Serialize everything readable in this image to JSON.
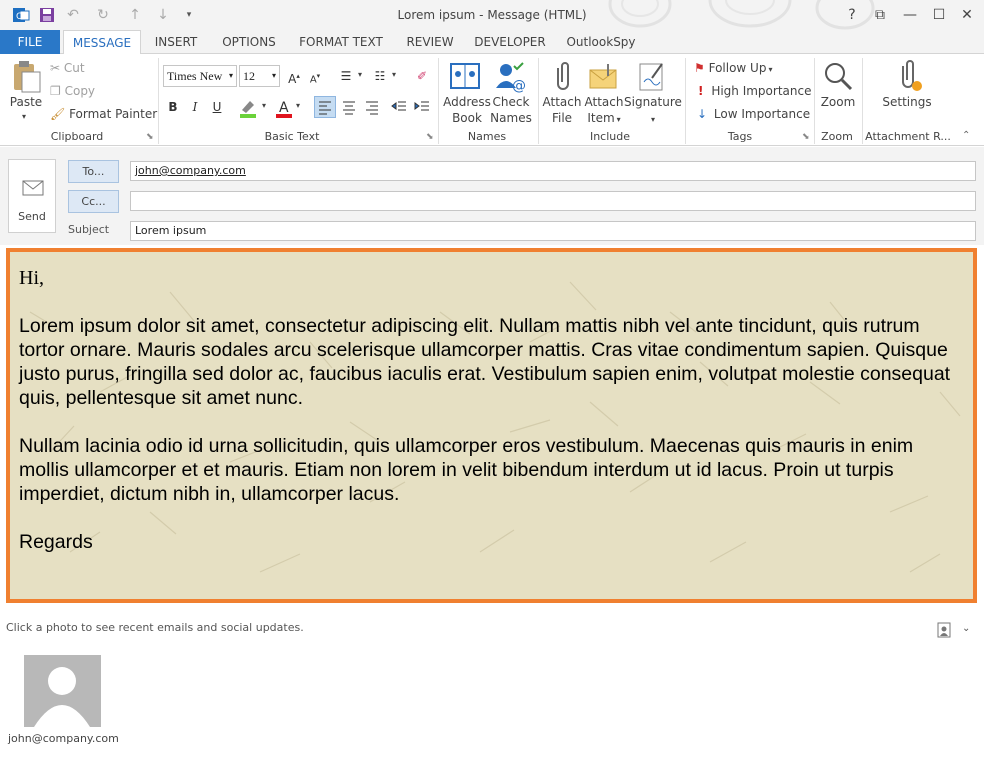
{
  "window": {
    "title": "Lorem ipsum - Message (HTML)",
    "help": "?",
    "restore_ribbon": "⧉",
    "minimize": "—",
    "maximize": "☐",
    "close": "✕"
  },
  "tabs": [
    {
      "label": "FILE"
    },
    {
      "label": "MESSAGE"
    },
    {
      "label": "INSERT"
    },
    {
      "label": "OPTIONS"
    },
    {
      "label": "FORMAT TEXT"
    },
    {
      "label": "REVIEW"
    },
    {
      "label": "DEVELOPER"
    },
    {
      "label": "OutlookSpy"
    }
  ],
  "clipboard": {
    "paste": "Paste",
    "cut": "Cut",
    "copy": "Copy",
    "format_painter": "Format Painter",
    "group": "Clipboard"
  },
  "basic_text": {
    "font": "Times New",
    "size": "12",
    "bold": "B",
    "italic": "I",
    "underline": "U",
    "group": "Basic Text"
  },
  "names": {
    "address_book_1": "Address",
    "address_book_2": "Book",
    "check_names_1": "Check",
    "check_names_2": "Names",
    "group": "Names"
  },
  "include": {
    "attach_file_1": "Attach",
    "attach_file_2": "File",
    "attach_item_1": "Attach",
    "attach_item_2": "Item",
    "signature": "Signature",
    "group": "Include"
  },
  "tags": {
    "follow_up": "Follow Up",
    "high": "High Importance",
    "low": "Low Importance",
    "group": "Tags"
  },
  "zoom": {
    "label": "Zoom",
    "group": "Zoom"
  },
  "attachment": {
    "label": "Settings",
    "group": "Attachment R..."
  },
  "compose": {
    "send": "Send",
    "to_button": "To...",
    "cc_button": "Cc...",
    "subject_label": "Subject",
    "to_value": "john@company.com",
    "cc_value": "",
    "subject_value": "Lorem ipsum"
  },
  "message": {
    "greeting": "Hi,",
    "para1": "Lorem ipsum dolor sit amet, consectetur adipiscing elit. Nullam mattis nibh vel ante tincidunt, quis rutrum tortor ornare. Mauris sodales arcu scelerisque ullamcorper mattis. Cras vitae condimentum sapien. Quisque justo purus, fringilla sed dolor ac, faucibus iaculis erat. Vestibulum sapien enim, volutpat molestie consequat quis, pellentesque sit amet nunc.",
    "para2": "Nullam lacinia odio id urna sollicitudin, quis ullamcorper eros vestibulum. Maecenas quis mauris in enim mollis ullamcorper et et mauris. Etiam non lorem in velit bibendum interdum ut id lacus. Proin ut turpis imperdiet, dictum nibh in, ullamcorper lacus.",
    "closing": "Regards"
  },
  "people_pane": {
    "hint": "Click a photo to see recent emails and social updates.",
    "contact": "john@company.com"
  },
  "colors": {
    "file_tab": "#2a78c8",
    "accent": "#2a6fbf",
    "body_border": "#f08030",
    "body_bg": "#e6e0c3"
  }
}
